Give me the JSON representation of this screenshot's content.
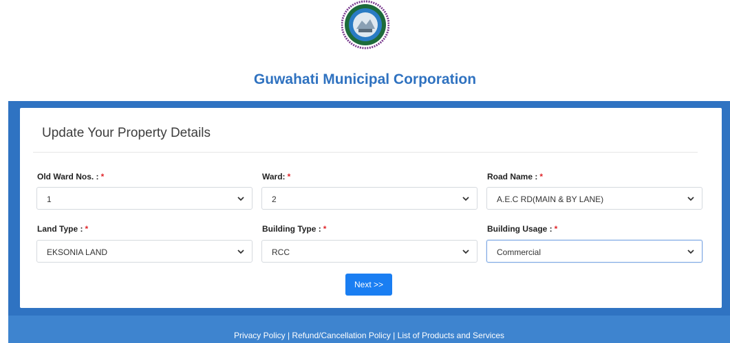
{
  "header": {
    "logo_icon": "guwahati-municipal-corporation-seal",
    "title": "Guwahati Municipal Corporation"
  },
  "form": {
    "heading": "Update Your Property Details",
    "required_mark": "*",
    "fields": {
      "old_ward": {
        "label": "Old Ward Nos. :",
        "value": "1"
      },
      "ward": {
        "label": "Ward:",
        "value": "2"
      },
      "road_name": {
        "label": "Road Name :",
        "value": "A.E.C RD(MAIN & BY LANE)"
      },
      "land_type": {
        "label": "Land Type :",
        "value": "EKSONIA LAND"
      },
      "building_type": {
        "label": "Building Type :",
        "value": "RCC"
      },
      "building_usage": {
        "label": "Building Usage :",
        "value": "Commercial"
      }
    },
    "next_button": "Next >>"
  },
  "footer": {
    "privacy": "Privacy Policy",
    "refund": "Refund/Cancellation Policy",
    "products": "List of Products and Services",
    "separator": " | "
  },
  "colors": {
    "brand_blue": "#2f73c2",
    "button_blue": "#1a7ef2",
    "required_red": "#e0262b",
    "footer_blue": "#3e84cf"
  }
}
